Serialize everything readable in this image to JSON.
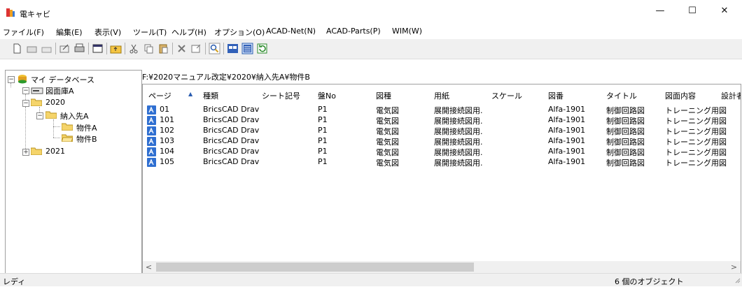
{
  "window": {
    "title": "電キャビ",
    "minimize": "—",
    "maximize": "☐",
    "close": "✕"
  },
  "menu": [
    "ファイル(F)",
    "編集(E)",
    "表示(V)",
    "ツール(T)",
    "ヘルプ(H)",
    "オプション(O)",
    "ACAD-Net(N)",
    "ACAD-Parts(P)",
    "WIM(W)"
  ],
  "toolbar": [
    "new-icon",
    "open-icon",
    "folder-icon",
    "edit-icon",
    "print-icon",
    "window-icon",
    "folder-up-icon",
    "cut-icon",
    "copy-icon",
    "paste-icon",
    "delete-icon",
    "properties-icon",
    "search-icon",
    "view-large-icon",
    "view-details-icon",
    "refresh-icon"
  ],
  "tree": {
    "root": "マイ データベース",
    "db": "図面庫A",
    "year1": "2020",
    "dest": "納入先A",
    "itemA": "物件A",
    "itemB": "物件B",
    "year2": "2021"
  },
  "path": "F:¥2020マニュアル改定¥2020¥納入先A¥物件B",
  "columns": [
    "ページ",
    "種類",
    "シート記号",
    "盤No",
    "図種",
    "用紙",
    "スケール",
    "図番",
    "タイトル",
    "図面内容",
    "設計者"
  ],
  "sort_indicator": "▲",
  "rows": [
    [
      "01",
      "BricsCAD Drav",
      "",
      "P1",
      "電気図",
      "展開接続図用.",
      "",
      "Alfa-1901",
      "制御回路図",
      "トレーニング用図"
    ],
    [
      "101",
      "BricsCAD Drav",
      "",
      "P1",
      "電気図",
      "展開接続図用.",
      "",
      "Alfa-1901",
      "制御回路図",
      "トレーニング用図"
    ],
    [
      "102",
      "BricsCAD Drav",
      "",
      "P1",
      "電気図",
      "展開接続図用.",
      "",
      "Alfa-1901",
      "制御回路図",
      "トレーニング用図"
    ],
    [
      "103",
      "BricsCAD Drav",
      "",
      "P1",
      "電気図",
      "展開接続図用.",
      "",
      "Alfa-1901",
      "制御回路図",
      "トレーニング用図"
    ],
    [
      "104",
      "BricsCAD Drav",
      "",
      "P1",
      "電気図",
      "展開接続図用.",
      "",
      "Alfa-1901",
      "制御回路図",
      "トレーニング用図"
    ],
    [
      "105",
      "BricsCAD Drav",
      "",
      "P1",
      "電気図",
      "展開接続図用.",
      "",
      "Alfa-1901",
      "制御回路図",
      "トレーニング用図"
    ]
  ],
  "status": {
    "left": "レディ",
    "right": "6 個のオブジェクト"
  },
  "scroll": {
    "left": "<",
    "right": ">"
  }
}
